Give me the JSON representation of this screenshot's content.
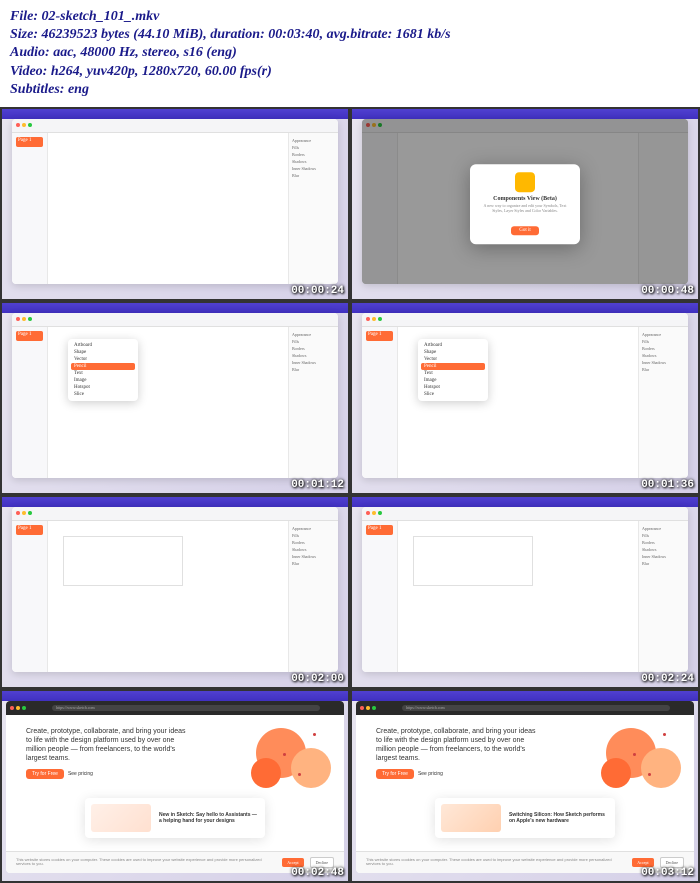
{
  "info": {
    "file_label": "File:",
    "file_name": "02-sketch_101_.mkv",
    "size_label": "Size:",
    "size_bytes": "46239523 bytes (44.10 MiB)",
    "duration_label": "duration:",
    "duration": "00:03:40",
    "bitrate_label": "avg.bitrate:",
    "bitrate": "1681 kb/s",
    "audio_label": "Audio:",
    "audio": "aac, 48000 Hz, stereo, s16 (eng)",
    "video_label": "Video:",
    "video": "h264, yuv420p, 1280x720, 60.00 fps(r)",
    "subs_label": "Subtitles:",
    "subs": "eng"
  },
  "timestamps": [
    "00:00:24",
    "00:00:48",
    "00:01:12",
    "00:01:36",
    "00:02:00",
    "00:02:24",
    "00:02:48",
    "00:03:12"
  ],
  "sidebar_item": "Page 1",
  "dropdown_items": [
    "Artboard",
    "Shape",
    "Vector",
    "Pencil",
    "Text",
    "Image",
    "Hotspot",
    "Slice"
  ],
  "dropdown_hl": 3,
  "inspector_labels": [
    "Appearance",
    "Fills",
    "Borders",
    "Shadows",
    "Inner Shadows",
    "Blur"
  ],
  "modal": {
    "title": "Components View (Beta)",
    "text": "A new way to organize and edit your Symbols, Text Styles, Layer Styles and Color Variables.",
    "button": "Got it"
  },
  "web": {
    "url": "https://www.sketch.com",
    "hero": "Create, prototype, collaborate, and bring your ideas to life with the design platform used by over one million people — from freelancers, to the world's largest teams.",
    "cta": "Try for Free",
    "cta2": "See pricing",
    "card1": "New in Sketch: Say hello to Assistants — a helping hand for your designs",
    "card2": "Switching Silicon: How Sketch performs on Apple's new hardware",
    "cookie_text": "This website stores cookies on your computer. These cookies are used to improve your website experience and provide more personalized services to you.",
    "cookie_accept": "Accept",
    "cookie_decline": "Decline"
  }
}
